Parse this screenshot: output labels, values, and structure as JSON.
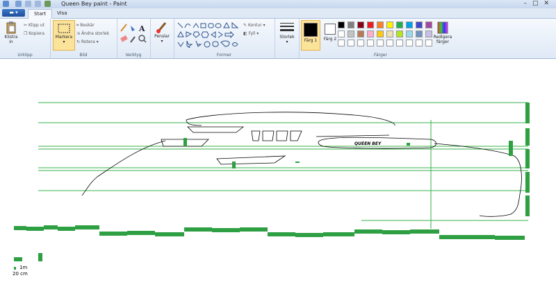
{
  "window": {
    "title": "Queen Bey paint - Paint"
  },
  "tabs": {
    "file": "▬ ▾",
    "start": "Start",
    "view": "Visa"
  },
  "groups": {
    "clipboard": {
      "label": "Urklipp",
      "paste": "Klistra in",
      "cut": "Klipp ut",
      "copy": "Kopiera"
    },
    "image": {
      "label": "Bild",
      "select": "Markera",
      "crop": "Beskär",
      "resize": "Ändra storlek",
      "rotate": "Rotera"
    },
    "tools": {
      "label": "Verktyg"
    },
    "brushes": {
      "label": "Penslar"
    },
    "shapes": {
      "label": "Former",
      "outline": "Kontur",
      "fill": "Fyll"
    },
    "size": {
      "label": "Storlek"
    },
    "colors": {
      "label": "Färger",
      "color1": "Färg 1",
      "color2": "Färg 2",
      "edit": "Redigera färger"
    }
  },
  "palette": {
    "row1": [
      "#000000",
      "#7f7f7f",
      "#880015",
      "#ed1c24",
      "#ff7f27",
      "#fff200",
      "#22b14c",
      "#00a2e8",
      "#3f48cc",
      "#a349a4"
    ],
    "row2": [
      "#ffffff",
      "#c3c3c3",
      "#b97a57",
      "#ffaec9",
      "#ffc90e",
      "#efe4b0",
      "#b5e61d",
      "#99d9ea",
      "#7092be",
      "#c8bfe7"
    ]
  },
  "colors": {
    "accent_green": "#2ea043",
    "line_green": "#35b04a",
    "color1": "#000000",
    "color2": "#ffffff"
  },
  "drawing": {
    "boat_name": "QUEEN BEY",
    "scale_label": "1m",
    "scale_sub": "20 cm"
  }
}
